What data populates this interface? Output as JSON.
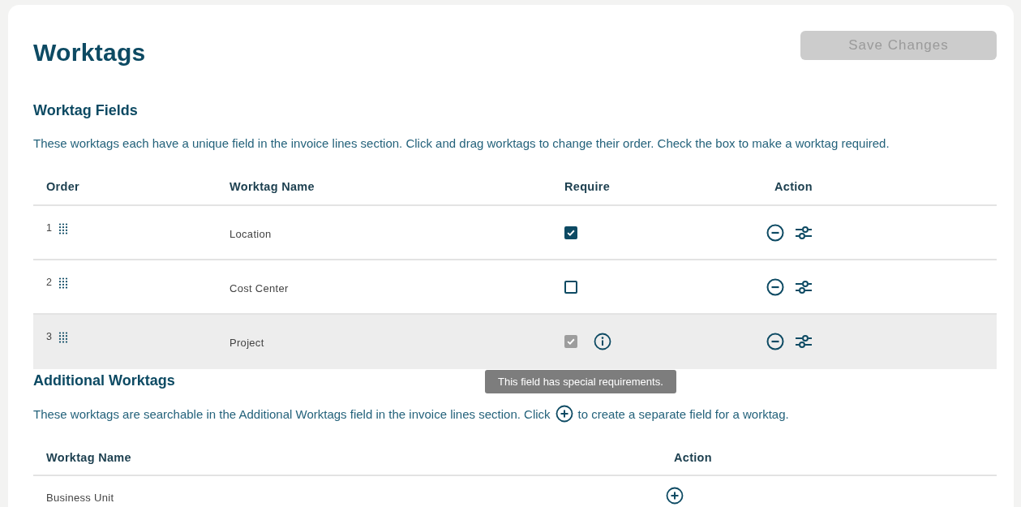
{
  "title": "Worktags",
  "save_button": {
    "label": "Save Changes",
    "disabled": true
  },
  "worktag_fields": {
    "heading": "Worktag Fields",
    "description": "These worktags each have a unique field in the invoice lines section. Click and drag worktags to change their order. Check the box to make a worktag required.",
    "columns": [
      "Order",
      "Worktag Name",
      "Require",
      "Action"
    ],
    "rows": [
      {
        "order": "1",
        "name": "Location",
        "checked": true,
        "disabled": false,
        "info": false,
        "highlighted": false
      },
      {
        "order": "2",
        "name": "Cost Center",
        "checked": false,
        "disabled": false,
        "info": false,
        "highlighted": false
      },
      {
        "order": "3",
        "name": "Project",
        "checked": true,
        "disabled": true,
        "info": true,
        "highlighted": true,
        "tooltip": "This field has special requirements."
      }
    ]
  },
  "additional_worktags": {
    "heading": "Additional Worktags",
    "description_before": "These worktags are searchable in the Additional Worktags field in the invoice lines section. Click",
    "description_after": "to create a separate field for a worktag.",
    "columns": [
      "Worktag Name",
      "Action"
    ],
    "rows": [
      {
        "name": "Business Unit"
      }
    ]
  }
}
